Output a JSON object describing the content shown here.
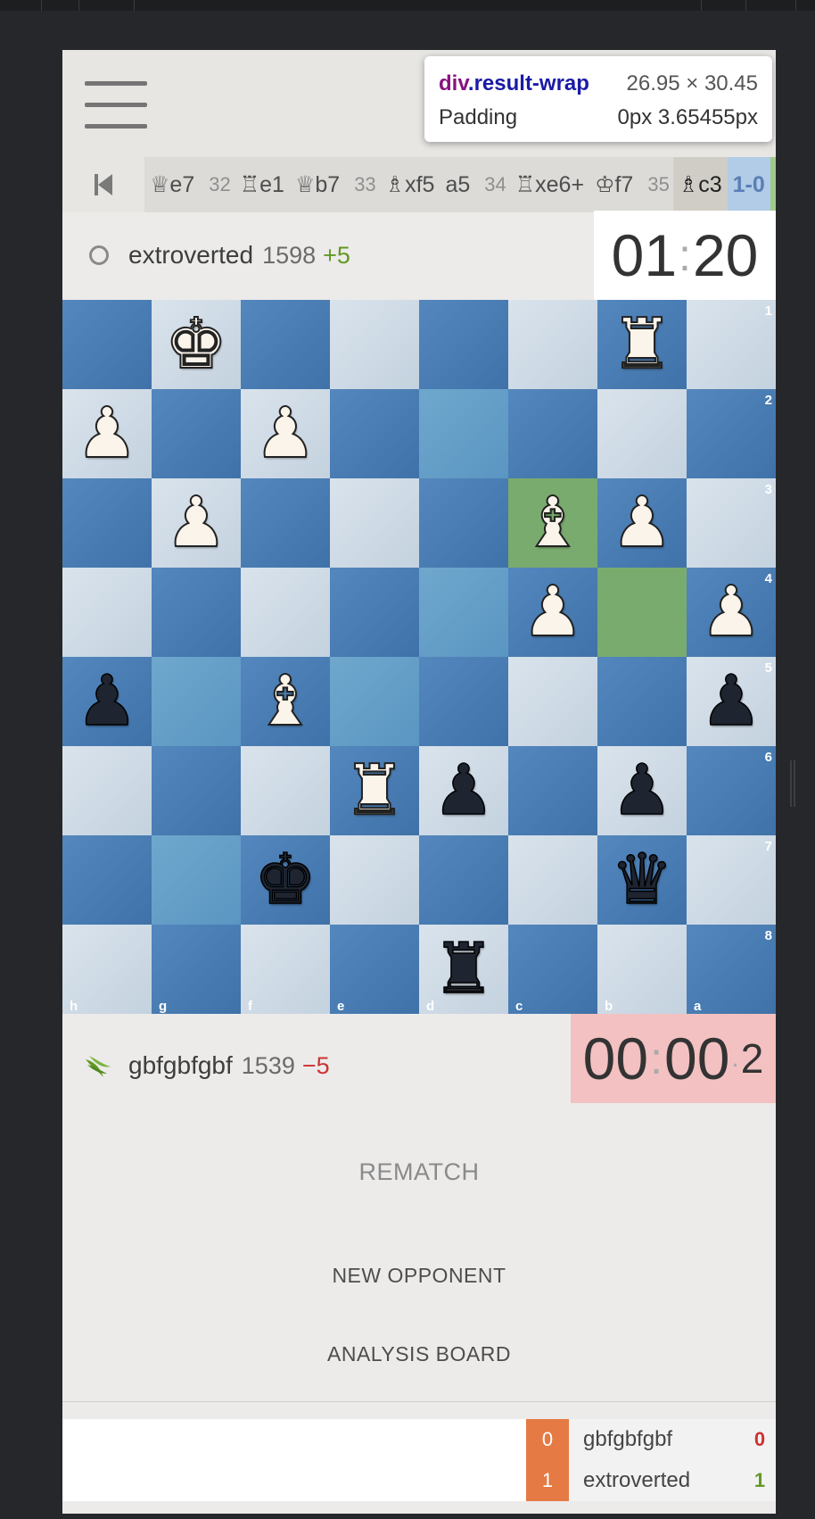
{
  "devtools_tooltip": {
    "tag": "div",
    "class_name": ".result-wrap",
    "size": "26.95 × 30.45",
    "property_label": "Padding",
    "property_value": "0px 3.65455px"
  },
  "moves": {
    "items": [
      {
        "kind": "move",
        "text": "♕e7"
      },
      {
        "kind": "num",
        "text": "32"
      },
      {
        "kind": "move",
        "text": "♖e1"
      },
      {
        "kind": "move",
        "text": "♕b7"
      },
      {
        "kind": "num",
        "text": "33"
      },
      {
        "kind": "move",
        "text": "♗xf5"
      },
      {
        "kind": "move",
        "text": "a5"
      },
      {
        "kind": "num",
        "text": "34"
      },
      {
        "kind": "move",
        "text": "♖xe6+"
      },
      {
        "kind": "move",
        "text": "♔f7"
      },
      {
        "kind": "num",
        "text": "35"
      },
      {
        "kind": "active",
        "text": "♗c3"
      },
      {
        "kind": "result",
        "text": "1-0"
      }
    ]
  },
  "top_player": {
    "name": "extroverted",
    "rating": "1598",
    "diff": "+5",
    "clock_min": "01",
    "clock_sec": "20",
    "icon": "offline-ring-icon"
  },
  "bottom_player": {
    "name": "gbfgbfgbf",
    "rating": "1539",
    "diff": "−5",
    "clock_min": "00",
    "clock_sec": "00",
    "clock_tenth": "2",
    "icon": "lichess-leaf-icon"
  },
  "board": {
    "orientation": "black",
    "highlight_squares": [
      "c3",
      "b4"
    ],
    "ranks": [
      "1",
      "2",
      "3",
      "4",
      "5",
      "6",
      "7",
      "8"
    ],
    "files": [
      "h",
      "g",
      "f",
      "e",
      "d",
      "c",
      "b",
      "a"
    ],
    "pieces": [
      {
        "square": "g1",
        "color": "white",
        "type": "king",
        "glyph": "♚"
      },
      {
        "square": "b1",
        "color": "white",
        "type": "rook",
        "glyph": "♜"
      },
      {
        "square": "h2",
        "color": "white",
        "type": "pawn",
        "glyph": "♟"
      },
      {
        "square": "f2",
        "color": "white",
        "type": "pawn",
        "glyph": "♟"
      },
      {
        "square": "g3",
        "color": "white",
        "type": "pawn",
        "glyph": "♟"
      },
      {
        "square": "c3",
        "color": "white",
        "type": "bishop",
        "glyph": "♝"
      },
      {
        "square": "b3",
        "color": "white",
        "type": "pawn",
        "glyph": "♟"
      },
      {
        "square": "c4",
        "color": "white",
        "type": "pawn",
        "glyph": "♟"
      },
      {
        "square": "a4",
        "color": "white",
        "type": "pawn",
        "glyph": "♟"
      },
      {
        "square": "h5",
        "color": "black",
        "type": "pawn",
        "glyph": "♟"
      },
      {
        "square": "f5",
        "color": "white",
        "type": "bishop",
        "glyph": "♝"
      },
      {
        "square": "a5",
        "color": "black",
        "type": "pawn",
        "glyph": "♟"
      },
      {
        "square": "e6",
        "color": "white",
        "type": "rook",
        "glyph": "♜"
      },
      {
        "square": "d6",
        "color": "black",
        "type": "pawn",
        "glyph": "♟"
      },
      {
        "square": "b6",
        "color": "black",
        "type": "pawn",
        "glyph": "♟"
      },
      {
        "square": "f7",
        "color": "black",
        "type": "king",
        "glyph": "♚"
      },
      {
        "square": "b7",
        "color": "black",
        "type": "queen",
        "glyph": "♛"
      },
      {
        "square": "d8",
        "color": "black",
        "type": "rook",
        "glyph": "♜"
      }
    ]
  },
  "actions": {
    "rematch": "REMATCH",
    "new_opponent": "NEW OPPONENT",
    "analysis_board": "ANALYSIS BOARD"
  },
  "score": {
    "rows": [
      {
        "count": "0",
        "name": "gbfgbfgbf",
        "points": "0",
        "color": "#cc3333"
      },
      {
        "count": "1",
        "name": "extroverted",
        "points": "1",
        "color": "#629924"
      }
    ]
  },
  "colors": {
    "accent_orange": "#e57a44",
    "positive": "#629924",
    "negative": "#cc3333",
    "low_time_clock": "#f3c1c1"
  }
}
